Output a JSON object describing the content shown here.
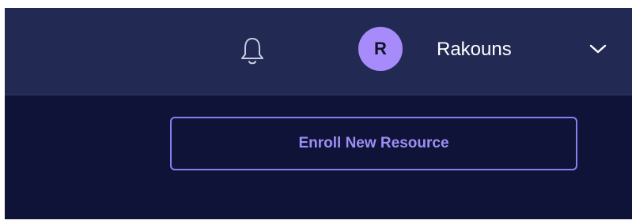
{
  "header": {
    "notifications_icon": "bell-icon",
    "user": {
      "avatar_initial": "R",
      "name": "Rakouns",
      "menu_icon": "chevron-down-icon"
    }
  },
  "main": {
    "enroll_button_label": "Enroll New Resource"
  },
  "colors": {
    "header_bg": "#222a54",
    "page_bg": "#0f1338",
    "avatar_bg": "#a78bfa",
    "accent": "#8b7cf0"
  }
}
